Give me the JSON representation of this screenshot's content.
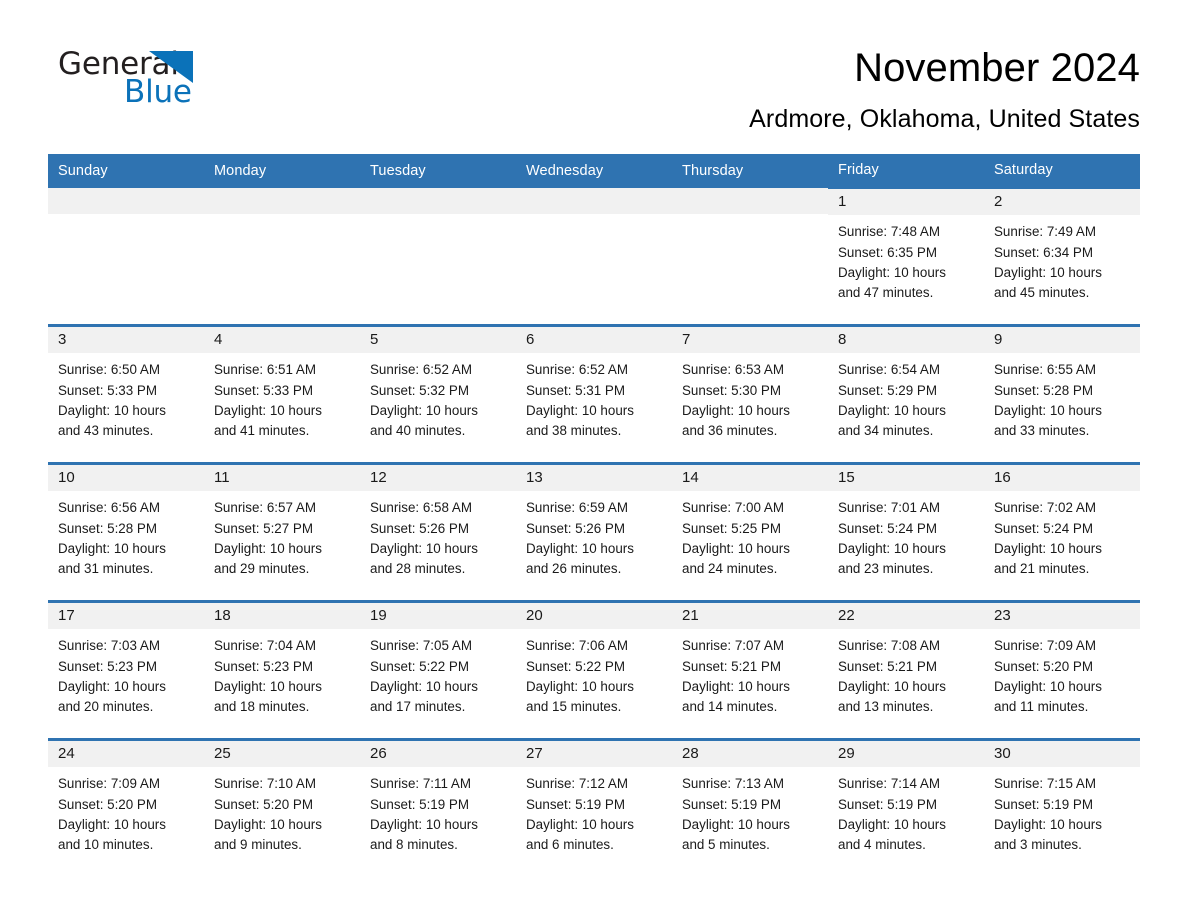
{
  "brand": {
    "name_part1": "General",
    "name_part2": "Blue",
    "triangle_icon": "triangle-icon",
    "accent_color": "#0b72b9"
  },
  "header": {
    "month_title": "November 2024",
    "location": "Ardmore, Oklahoma, United States"
  },
  "calendar": {
    "header_bg": "#2f73b1",
    "cell_band_bg": "#f1f1f1",
    "weekdays": [
      "Sunday",
      "Monday",
      "Tuesday",
      "Wednesday",
      "Thursday",
      "Friday",
      "Saturday"
    ],
    "weeks": [
      [
        {
          "empty": true
        },
        {
          "empty": true
        },
        {
          "empty": true
        },
        {
          "empty": true
        },
        {
          "empty": true
        },
        {
          "day": "1",
          "sunrise": "Sunrise: 7:48 AM",
          "sunset": "Sunset: 6:35 PM",
          "daylight_line1": "Daylight: 10 hours",
          "daylight_line2": "and 47 minutes."
        },
        {
          "day": "2",
          "sunrise": "Sunrise: 7:49 AM",
          "sunset": "Sunset: 6:34 PM",
          "daylight_line1": "Daylight: 10 hours",
          "daylight_line2": "and 45 minutes."
        }
      ],
      [
        {
          "day": "3",
          "sunrise": "Sunrise: 6:50 AM",
          "sunset": "Sunset: 5:33 PM",
          "daylight_line1": "Daylight: 10 hours",
          "daylight_line2": "and 43 minutes."
        },
        {
          "day": "4",
          "sunrise": "Sunrise: 6:51 AM",
          "sunset": "Sunset: 5:33 PM",
          "daylight_line1": "Daylight: 10 hours",
          "daylight_line2": "and 41 minutes."
        },
        {
          "day": "5",
          "sunrise": "Sunrise: 6:52 AM",
          "sunset": "Sunset: 5:32 PM",
          "daylight_line1": "Daylight: 10 hours",
          "daylight_line2": "and 40 minutes."
        },
        {
          "day": "6",
          "sunrise": "Sunrise: 6:52 AM",
          "sunset": "Sunset: 5:31 PM",
          "daylight_line1": "Daylight: 10 hours",
          "daylight_line2": "and 38 minutes."
        },
        {
          "day": "7",
          "sunrise": "Sunrise: 6:53 AM",
          "sunset": "Sunset: 5:30 PM",
          "daylight_line1": "Daylight: 10 hours",
          "daylight_line2": "and 36 minutes."
        },
        {
          "day": "8",
          "sunrise": "Sunrise: 6:54 AM",
          "sunset": "Sunset: 5:29 PM",
          "daylight_line1": "Daylight: 10 hours",
          "daylight_line2": "and 34 minutes."
        },
        {
          "day": "9",
          "sunrise": "Sunrise: 6:55 AM",
          "sunset": "Sunset: 5:28 PM",
          "daylight_line1": "Daylight: 10 hours",
          "daylight_line2": "and 33 minutes."
        }
      ],
      [
        {
          "day": "10",
          "sunrise": "Sunrise: 6:56 AM",
          "sunset": "Sunset: 5:28 PM",
          "daylight_line1": "Daylight: 10 hours",
          "daylight_line2": "and 31 minutes."
        },
        {
          "day": "11",
          "sunrise": "Sunrise: 6:57 AM",
          "sunset": "Sunset: 5:27 PM",
          "daylight_line1": "Daylight: 10 hours",
          "daylight_line2": "and 29 minutes."
        },
        {
          "day": "12",
          "sunrise": "Sunrise: 6:58 AM",
          "sunset": "Sunset: 5:26 PM",
          "daylight_line1": "Daylight: 10 hours",
          "daylight_line2": "and 28 minutes."
        },
        {
          "day": "13",
          "sunrise": "Sunrise: 6:59 AM",
          "sunset": "Sunset: 5:26 PM",
          "daylight_line1": "Daylight: 10 hours",
          "daylight_line2": "and 26 minutes."
        },
        {
          "day": "14",
          "sunrise": "Sunrise: 7:00 AM",
          "sunset": "Sunset: 5:25 PM",
          "daylight_line1": "Daylight: 10 hours",
          "daylight_line2": "and 24 minutes."
        },
        {
          "day": "15",
          "sunrise": "Sunrise: 7:01 AM",
          "sunset": "Sunset: 5:24 PM",
          "daylight_line1": "Daylight: 10 hours",
          "daylight_line2": "and 23 minutes."
        },
        {
          "day": "16",
          "sunrise": "Sunrise: 7:02 AM",
          "sunset": "Sunset: 5:24 PM",
          "daylight_line1": "Daylight: 10 hours",
          "daylight_line2": "and 21 minutes."
        }
      ],
      [
        {
          "day": "17",
          "sunrise": "Sunrise: 7:03 AM",
          "sunset": "Sunset: 5:23 PM",
          "daylight_line1": "Daylight: 10 hours",
          "daylight_line2": "and 20 minutes."
        },
        {
          "day": "18",
          "sunrise": "Sunrise: 7:04 AM",
          "sunset": "Sunset: 5:23 PM",
          "daylight_line1": "Daylight: 10 hours",
          "daylight_line2": "and 18 minutes."
        },
        {
          "day": "19",
          "sunrise": "Sunrise: 7:05 AM",
          "sunset": "Sunset: 5:22 PM",
          "daylight_line1": "Daylight: 10 hours",
          "daylight_line2": "and 17 minutes."
        },
        {
          "day": "20",
          "sunrise": "Sunrise: 7:06 AM",
          "sunset": "Sunset: 5:22 PM",
          "daylight_line1": "Daylight: 10 hours",
          "daylight_line2": "and 15 minutes."
        },
        {
          "day": "21",
          "sunrise": "Sunrise: 7:07 AM",
          "sunset": "Sunset: 5:21 PM",
          "daylight_line1": "Daylight: 10 hours",
          "daylight_line2": "and 14 minutes."
        },
        {
          "day": "22",
          "sunrise": "Sunrise: 7:08 AM",
          "sunset": "Sunset: 5:21 PM",
          "daylight_line1": "Daylight: 10 hours",
          "daylight_line2": "and 13 minutes."
        },
        {
          "day": "23",
          "sunrise": "Sunrise: 7:09 AM",
          "sunset": "Sunset: 5:20 PM",
          "daylight_line1": "Daylight: 10 hours",
          "daylight_line2": "and 11 minutes."
        }
      ],
      [
        {
          "day": "24",
          "sunrise": "Sunrise: 7:09 AM",
          "sunset": "Sunset: 5:20 PM",
          "daylight_line1": "Daylight: 10 hours",
          "daylight_line2": "and 10 minutes."
        },
        {
          "day": "25",
          "sunrise": "Sunrise: 7:10 AM",
          "sunset": "Sunset: 5:20 PM",
          "daylight_line1": "Daylight: 10 hours",
          "daylight_line2": "and 9 minutes."
        },
        {
          "day": "26",
          "sunrise": "Sunrise: 7:11 AM",
          "sunset": "Sunset: 5:19 PM",
          "daylight_line1": "Daylight: 10 hours",
          "daylight_line2": "and 8 minutes."
        },
        {
          "day": "27",
          "sunrise": "Sunrise: 7:12 AM",
          "sunset": "Sunset: 5:19 PM",
          "daylight_line1": "Daylight: 10 hours",
          "daylight_line2": "and 6 minutes."
        },
        {
          "day": "28",
          "sunrise": "Sunrise: 7:13 AM",
          "sunset": "Sunset: 5:19 PM",
          "daylight_line1": "Daylight: 10 hours",
          "daylight_line2": "and 5 minutes."
        },
        {
          "day": "29",
          "sunrise": "Sunrise: 7:14 AM",
          "sunset": "Sunset: 5:19 PM",
          "daylight_line1": "Daylight: 10 hours",
          "daylight_line2": "and 4 minutes."
        },
        {
          "day": "30",
          "sunrise": "Sunrise: 7:15 AM",
          "sunset": "Sunset: 5:19 PM",
          "daylight_line1": "Daylight: 10 hours",
          "daylight_line2": "and 3 minutes."
        }
      ]
    ]
  }
}
